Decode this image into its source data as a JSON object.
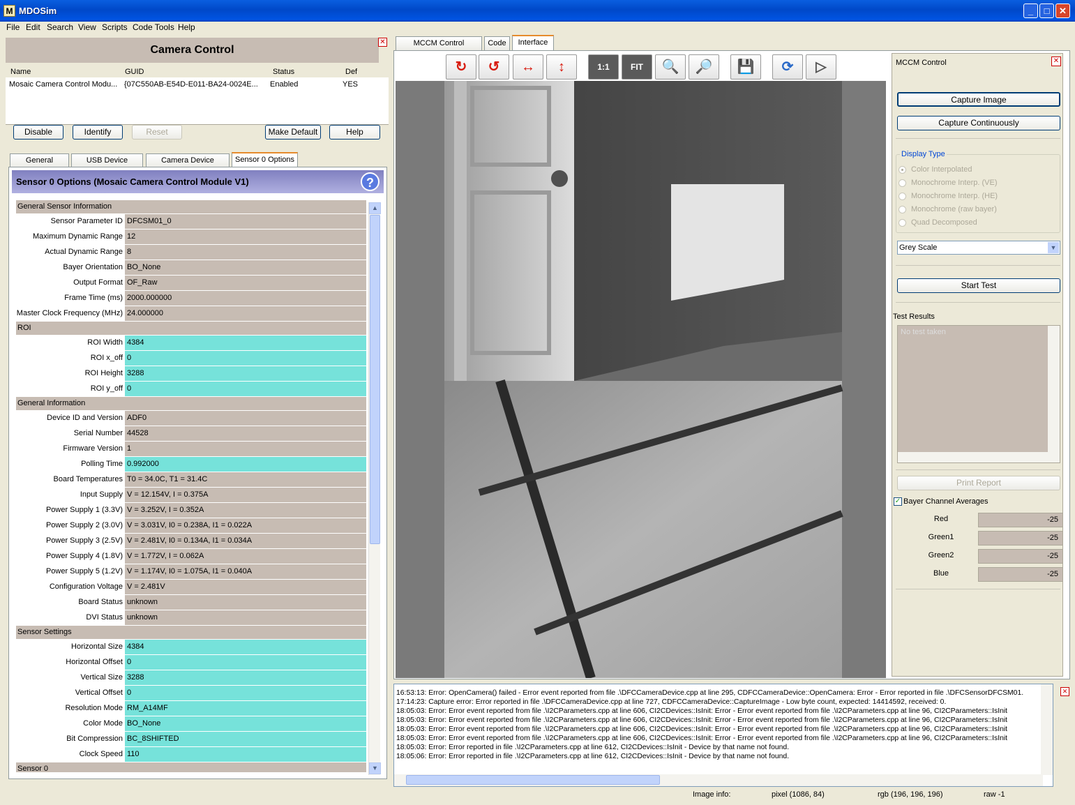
{
  "window": {
    "title": "MDOSim",
    "icon_letter": "M",
    "minimize": "_",
    "maximize": "□",
    "close": "✕"
  },
  "menu": [
    "File",
    "Edit",
    "Search",
    "View",
    "Scripts",
    "Code Tools",
    "Help"
  ],
  "left": {
    "title": "Camera Control",
    "close_glyph": "✕",
    "table_headers": [
      "Name",
      "GUID",
      "Status",
      "Def"
    ],
    "module": {
      "name": "Mosaic Camera Control Modu...",
      "guid": "{07C550AB-E54D-E011-BA24-0024E...",
      "status": "Enabled",
      "def": "YES"
    },
    "buttons": {
      "disable": "Disable",
      "identify": "Identify",
      "reset": "Reset",
      "make_default": "Make Default",
      "help": "Help"
    },
    "tabs": [
      "General Options",
      "USB Device Options",
      "Camera Device Options",
      "Sensor 0 Options"
    ],
    "sensor_header": "Sensor 0 Options (Mosaic Camera Control Module V1)",
    "help_glyph": "?",
    "rows": [
      {
        "t": "section",
        "label": "General Sensor Information"
      },
      {
        "t": "ro",
        "label": "Sensor Parameter ID",
        "value": "DFCSM01_0"
      },
      {
        "t": "ro",
        "label": "Maximum Dynamic Range",
        "value": "12"
      },
      {
        "t": "ro",
        "label": "Actual Dynamic Range",
        "value": "8"
      },
      {
        "t": "ro",
        "label": "Bayer Orientation",
        "value": "BO_None"
      },
      {
        "t": "ro",
        "label": "Output Format",
        "value": "OF_Raw"
      },
      {
        "t": "ro",
        "label": "Frame Time (ms)",
        "value": "2000.000000"
      },
      {
        "t": "ro",
        "label": "Master Clock Frequency (MHz)",
        "value": "24.000000"
      },
      {
        "t": "section",
        "label": "ROI"
      },
      {
        "t": "ed",
        "label": "ROI Width",
        "value": "4384"
      },
      {
        "t": "ed",
        "label": "ROI x_off",
        "value": "0"
      },
      {
        "t": "ed",
        "label": "ROI Height",
        "value": "3288"
      },
      {
        "t": "ed",
        "label": "ROI y_off",
        "value": "0"
      },
      {
        "t": "section",
        "label": "General Information"
      },
      {
        "t": "ro",
        "label": "Device ID and Version",
        "value": "ADF0"
      },
      {
        "t": "ro",
        "label": "Serial Number",
        "value": "44528"
      },
      {
        "t": "ro",
        "label": "Firmware Version",
        "value": "1"
      },
      {
        "t": "ed",
        "label": "Polling Time",
        "value": "0.992000"
      },
      {
        "t": "ro",
        "label": "Board Temperatures",
        "value": "T0 = 34.0C, T1 = 31.4C"
      },
      {
        "t": "ro",
        "label": "Input Supply",
        "value": "V = 12.154V, I = 0.375A"
      },
      {
        "t": "ro",
        "label": "Power Supply 1 (3.3V)",
        "value": "V = 3.252V, I = 0.352A"
      },
      {
        "t": "ro",
        "label": "Power Supply 2 (3.0V)",
        "value": "V = 3.031V, I0 = 0.238A, I1 = 0.022A"
      },
      {
        "t": "ro",
        "label": "Power Supply 3 (2.5V)",
        "value": "V = 2.481V, I0 = 0.134A, I1 = 0.034A"
      },
      {
        "t": "ro",
        "label": "Power Supply 4 (1.8V)",
        "value": "V = 1.772V, I = 0.062A"
      },
      {
        "t": "ro",
        "label": "Power Supply 5 (1.2V)",
        "value": "V = 1.174V, I0 = 1.075A, I1 = 0.040A"
      },
      {
        "t": "ro",
        "label": "Configuration Voltage",
        "value": "V = 2.481V"
      },
      {
        "t": "ro",
        "label": "Board Status",
        "value": "unknown"
      },
      {
        "t": "ro",
        "label": "DVI Status",
        "value": "unknown"
      },
      {
        "t": "section",
        "label": "Sensor Settings"
      },
      {
        "t": "ed",
        "label": "Horizontal Size",
        "value": "4384"
      },
      {
        "t": "ed",
        "label": "Horizontal Offset",
        "value": "0"
      },
      {
        "t": "ed",
        "label": "Vertical Size",
        "value": "3288"
      },
      {
        "t": "ed",
        "label": "Vertical Offset",
        "value": "0"
      },
      {
        "t": "ed",
        "label": "Resolution Mode",
        "value": "RM_A14MF"
      },
      {
        "t": "ed",
        "label": "Color Mode",
        "value": "BO_None"
      },
      {
        "t": "ed",
        "label": "Bit Compression",
        "value": "BC_8SHIFTED"
      },
      {
        "t": "ed",
        "label": "Clock Speed",
        "value": "110"
      },
      {
        "t": "section",
        "label": "Sensor 0"
      }
    ]
  },
  "right": {
    "tabs": [
      "MCCM Control Overview",
      "Code",
      "Interface"
    ],
    "toolbar": [
      {
        "name": "rotate-cw-icon",
        "glyph": "↻",
        "color": "#d81c10"
      },
      {
        "name": "rotate-ccw-icon",
        "glyph": "↺",
        "color": "#d81c10"
      },
      {
        "name": "flip-horizontal-icon",
        "glyph": "↔",
        "color": "#d81c10"
      },
      {
        "name": "flip-vertical-icon",
        "glyph": "↕",
        "color": "#d81c10"
      },
      {
        "name": "actual-size-icon",
        "glyph": "1:1",
        "color": "#ffffff"
      },
      {
        "name": "fit-icon",
        "glyph": "FIT",
        "color": "#ffffff"
      },
      {
        "name": "zoom-in-icon",
        "glyph": "🔍",
        "color": "#000000"
      },
      {
        "name": "zoom-out-icon",
        "glyph": "🔎",
        "color": "#000000"
      },
      {
        "name": "save-icon",
        "glyph": "💾",
        "color": "#1a4a9a"
      },
      {
        "name": "refresh-icon",
        "glyph": "⟳",
        "color": "#2a6ac8"
      },
      {
        "name": "play-icon",
        "glyph": "▷",
        "color": "#555555"
      }
    ],
    "mccm": {
      "title": "MCCM Control",
      "capture_image": "Capture Image",
      "capture_continuously": "Capture Continuously",
      "display_type_label": "Display Type",
      "display_types": [
        "Color Interpolated",
        "Monochrome Interp. (VE)",
        "Monochrome Interp. (HE)",
        "Monochrome (raw bayer)",
        "Quad Decomposed"
      ],
      "grey_select": "Grey Scale",
      "start_test": "Start Test",
      "test_results_label": "Test Results",
      "test_results_placeholder": "No test taken",
      "print_report": "Print Report",
      "bayer_checkbox": "Bayer Channel Averages",
      "channels": [
        {
          "label": "Red",
          "value": "-25"
        },
        {
          "label": "Green1",
          "value": "-25"
        },
        {
          "label": "Green2",
          "value": "-25"
        },
        {
          "label": "Blue",
          "value": "-25"
        }
      ]
    },
    "log": [
      "16:53:13: Error: OpenCamera() failed - Error event reported from file .\\DFCCameraDevice.cpp at line 295, CDFCCameraDevice::OpenCamera: Error - Error reported in file .\\DFCSensorDFCSM01.",
      "17:14:23: Capture error: Error reported in file .\\DFCCameraDevice.cpp at line 727, CDFCCameraDevice::CaptureImage - Low byte count, expected: 14414592, received: 0.",
      "18:05:03: Error: Error event reported from file .\\I2CParameters.cpp at line 606, CI2CDevices::IsInit: Error - Error event reported from file .\\I2CParameters.cpp at line 96, CI2CParameters::IsInit",
      "18:05:03: Error: Error event reported from file .\\I2CParameters.cpp at line 606, CI2CDevices::IsInit: Error - Error event reported from file .\\I2CParameters.cpp at line 96, CI2CParameters::IsInit",
      "18:05:03: Error: Error event reported from file .\\I2CParameters.cpp at line 606, CI2CDevices::IsInit: Error - Error event reported from file .\\I2CParameters.cpp at line 96, CI2CParameters::IsInit",
      "18:05:03: Error: Error event reported from file .\\I2CParameters.cpp at line 606, CI2CDevices::IsInit: Error - Error event reported from file .\\I2CParameters.cpp at line 96, CI2CParameters::IsInit",
      "18:05:03: Error: Error reported in file .\\I2CParameters.cpp at line 612, CI2CDevices::IsInit - Device by that name not found.",
      "18:05:06: Error: Error reported in file .\\I2CParameters.cpp at line 612, CI2CDevices::IsInit - Device by that name not found."
    ]
  },
  "status": {
    "image_info_label": "Image info:",
    "pixel": "pixel (1086,   84)",
    "rgb": "rgb (196, 196, 196)",
    "raw": "raw    -1"
  }
}
